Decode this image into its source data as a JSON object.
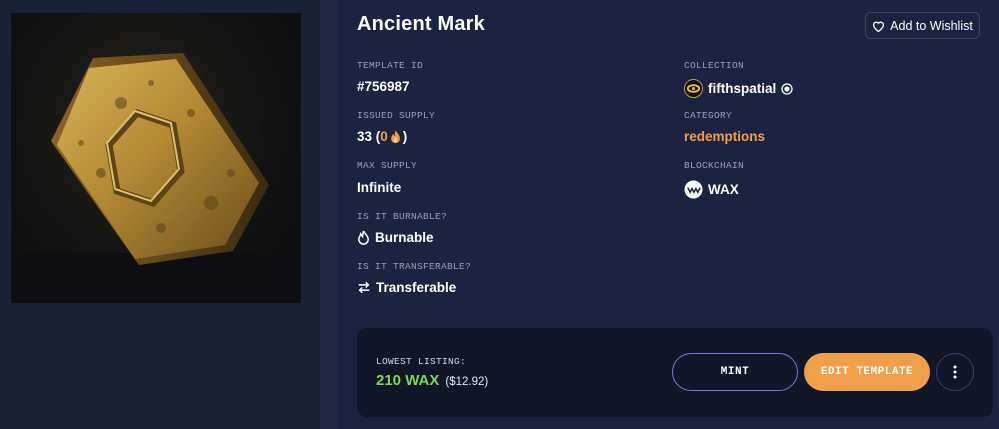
{
  "asset": {
    "title": "Ancient Mark",
    "image_alt": "gold hexagonal coin"
  },
  "wishlist": {
    "label": "Add to Wishlist",
    "icon": "heart-outline-icon"
  },
  "fields": {
    "template_id": {
      "label": "TEMPLATE ID",
      "value": "#756987"
    },
    "collection": {
      "label": "COLLECTION",
      "value": "fifthspatial",
      "icon": "collection-logo-icon",
      "verified_icon": "verified-badge-icon"
    },
    "issued_supply": {
      "label": "ISSUED SUPPLY",
      "count": "33",
      "open": " (",
      "burned": "0",
      "close": ")",
      "burn_icon": "flame-icon"
    },
    "category": {
      "label": "CATEGORY",
      "value": "redemptions"
    },
    "max_supply": {
      "label": "MAX SUPPLY",
      "value": "Infinite"
    },
    "blockchain": {
      "label": "BLOCKCHAIN",
      "value": "WAX",
      "icon": "wax-logo-icon"
    },
    "burnable": {
      "label": "IS IT BURNABLE?",
      "value": "Burnable",
      "icon": "flame-outline-icon"
    },
    "transferable": {
      "label": "IS IT TRANSFERABLE?",
      "value": "Transferable",
      "icon": "transfer-arrows-icon"
    }
  },
  "listing": {
    "label": "LOWEST LISTING:",
    "price_wax": "210 WAX",
    "price_usd": "($12.92)",
    "mint_label": "MINT",
    "edit_label": "EDIT TEMPLATE",
    "more_icon": "more-vertical-icon"
  },
  "colors": {
    "accent_orange": "#f0a04b",
    "price_green": "#7ed957",
    "mint_border": "#7e74e6",
    "background": "#1c2340"
  }
}
